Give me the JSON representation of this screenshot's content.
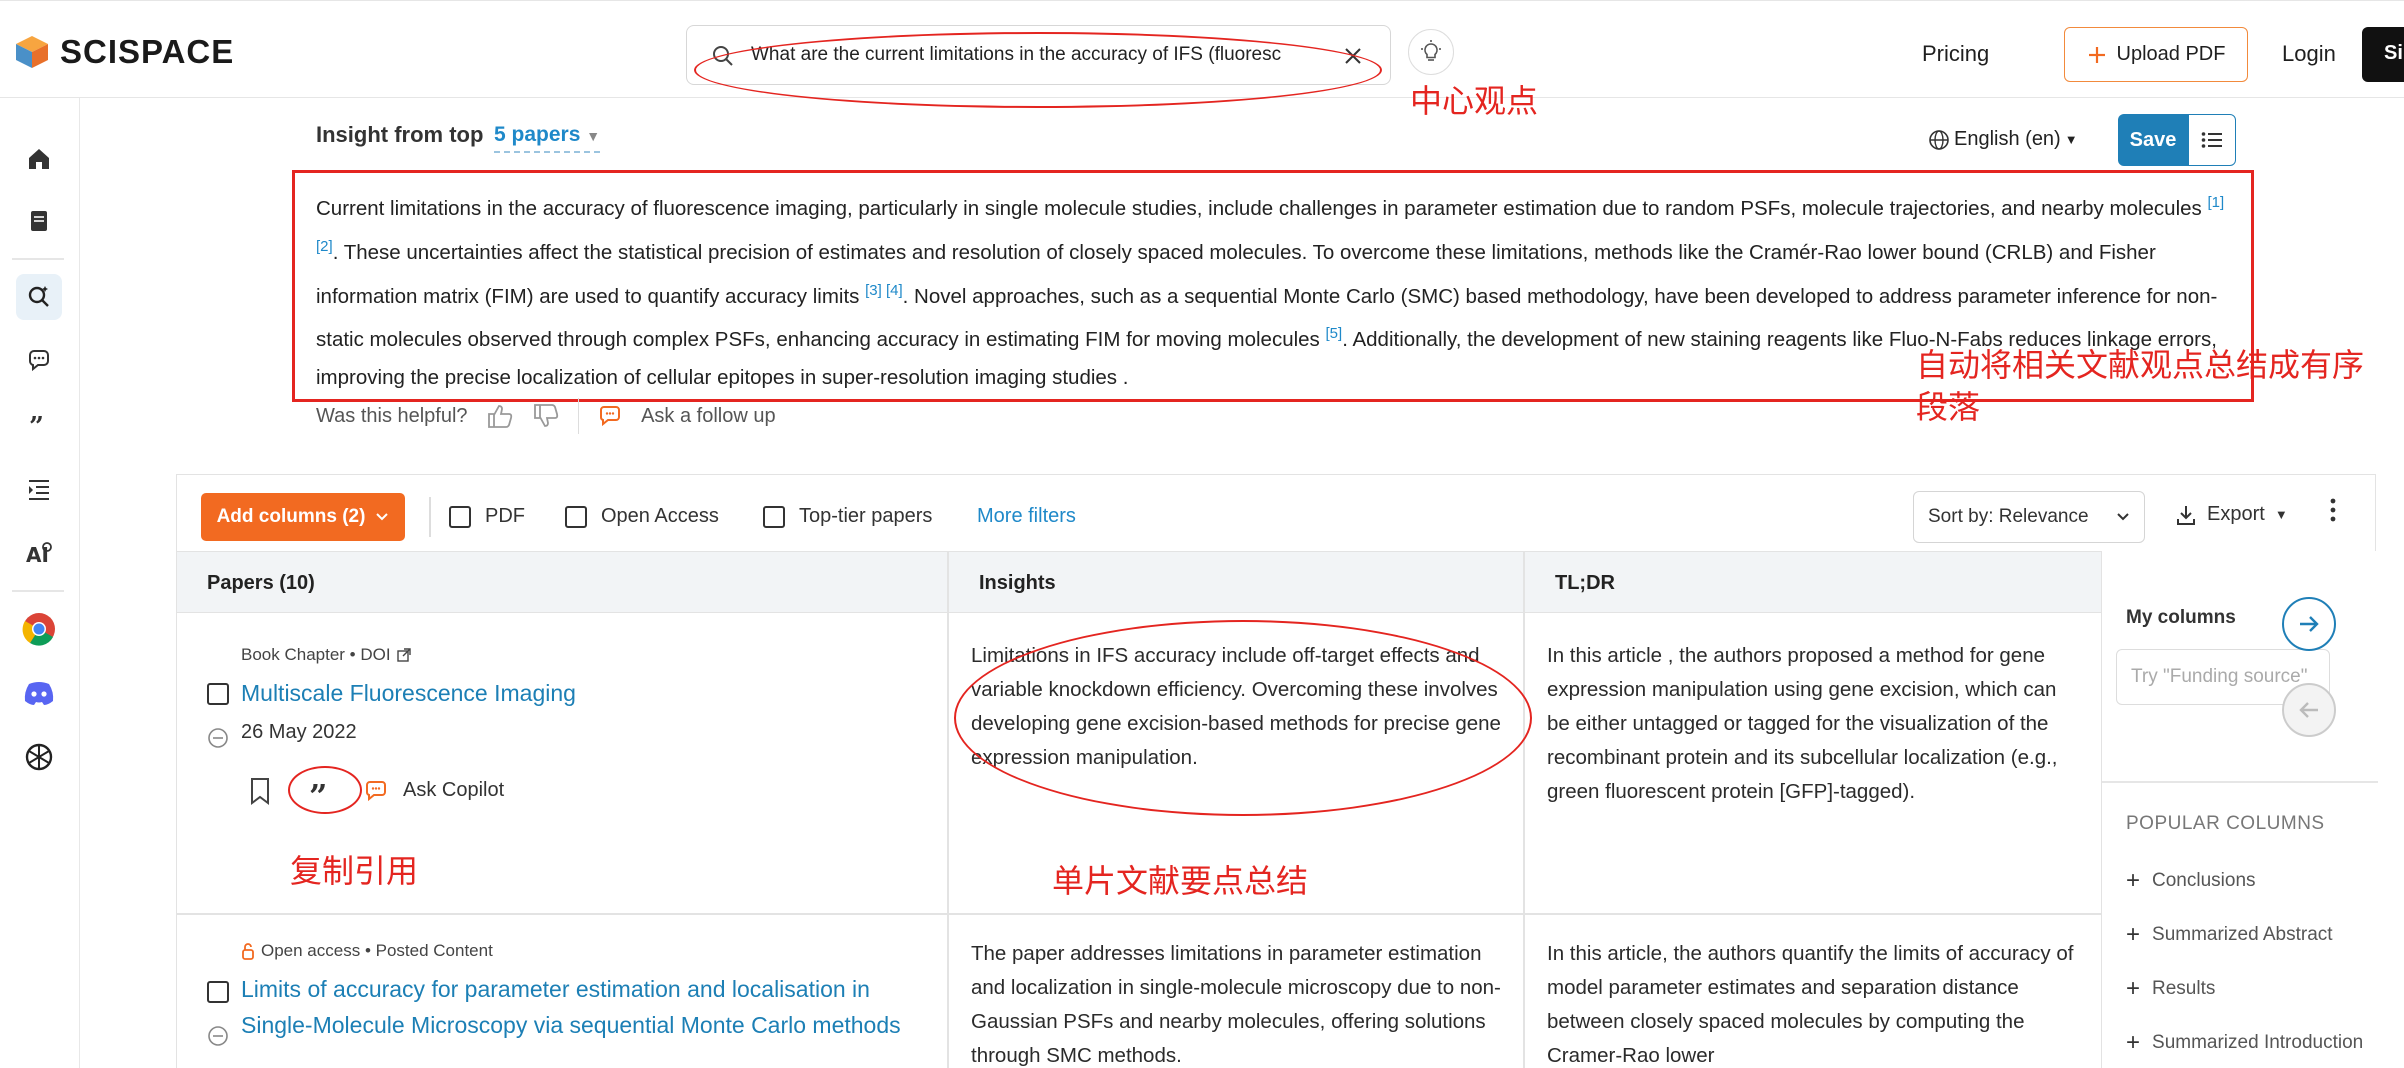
{
  "header": {
    "brand": "SCISPACE",
    "search_query": "What are the current limitations in the accuracy of IFS (fluoresc",
    "pricing": "Pricing",
    "upload_pdf": "Upload PDF",
    "login": "Login",
    "signup": "Si"
  },
  "insight": {
    "prefix": "Insight from top",
    "papers_link": "5 papers",
    "language": "English (en)",
    "save": "Save",
    "summary_parts": [
      "Current limitations in the accuracy of fluorescence imaging, particularly in single molecule studies, include challenges in parameter estimation due to random PSFs, molecule trajectories, and nearby molecules ",
      ". These uncertainties affect the statistical precision of estimates and resolution of closely spaced molecules. To overcome these limitations, methods like the Cramér-Rao lower bound (CRLB) and Fisher information matrix (FIM) are used to quantify accuracy limits ",
      ". Novel approaches, such as a sequential Monte Carlo (SMC) based methodology, have been developed to address parameter inference for non-static molecules observed through complex PSFs, enhancing accuracy in estimating FIM for moving molecules ",
      ". Additionally, the development of new staining reagents like Fluo-N-Fabs reduces linkage errors, improving the precise localization of cellular epitopes in super-resolution imaging studies ."
    ],
    "citations": [
      "[1] [2]",
      "[3] [4]",
      "[5]"
    ],
    "helpful_label": "Was this helpful?",
    "follow_up": "Ask a follow up"
  },
  "toolbar": {
    "add_columns": "Add columns (2)",
    "filter_pdf": "PDF",
    "filter_open_access": "Open Access",
    "filter_top_tier": "Top-tier papers",
    "more_filters": "More filters",
    "sort": "Sort by: Relevance",
    "export": "Export"
  },
  "table": {
    "headers": [
      "Papers (10)",
      "Insights",
      "TL;DR"
    ],
    "rows": [
      {
        "meta": "Book Chapter • DOI",
        "title": "Multiscale Fluorescence Imaging",
        "date": "26 May 2022",
        "ask_copilot": "Ask Copilot",
        "insight": "Limitations in IFS accuracy include off-target effects and variable knockdown efficiency. Overcoming these involves developing gene excision-based methods for precise gene expression manipulation.",
        "tldr": "In this article , the authors proposed a method for gene expression manipulation using gene excision, which can be either untagged or tagged for the visualization of the recombinant protein and its subcellular localization (e.g., green fluorescent protein [GFP]-tagged)."
      },
      {
        "meta": "Open access • Posted Content",
        "title": "Limits of accuracy for parameter estimation and localisation in Single-Molecule Microscopy via sequential Monte Carlo methods",
        "insight": "The paper addresses limitations in parameter estimation and localization in single-molecule microscopy due to non-Gaussian PSFs and nearby molecules, offering solutions through SMC methods.",
        "tldr": "In this article, the authors quantify the limits of accuracy of model parameter estimates and separation distance between closely spaced molecules by computing the Cramer-Rao lower"
      }
    ]
  },
  "my_columns": {
    "title": "My columns",
    "placeholder": "Try \"Funding source\"",
    "popular_title": "POPULAR COLUMNS",
    "popular": [
      "Conclusions",
      "Summarized Abstract",
      "Results",
      "Summarized Introduction"
    ]
  },
  "annotations": {
    "central_view": "中心观点",
    "auto_summary": "自动将相关文献观点总结成有序段落",
    "copy_citation": "复制引用",
    "single_summary": "单片文献要点总结"
  },
  "colors": {
    "accent_blue": "#1f89c9",
    "save_blue": "#1f7fb7",
    "orange": "#f26a21",
    "annotation_red": "#e42520"
  }
}
